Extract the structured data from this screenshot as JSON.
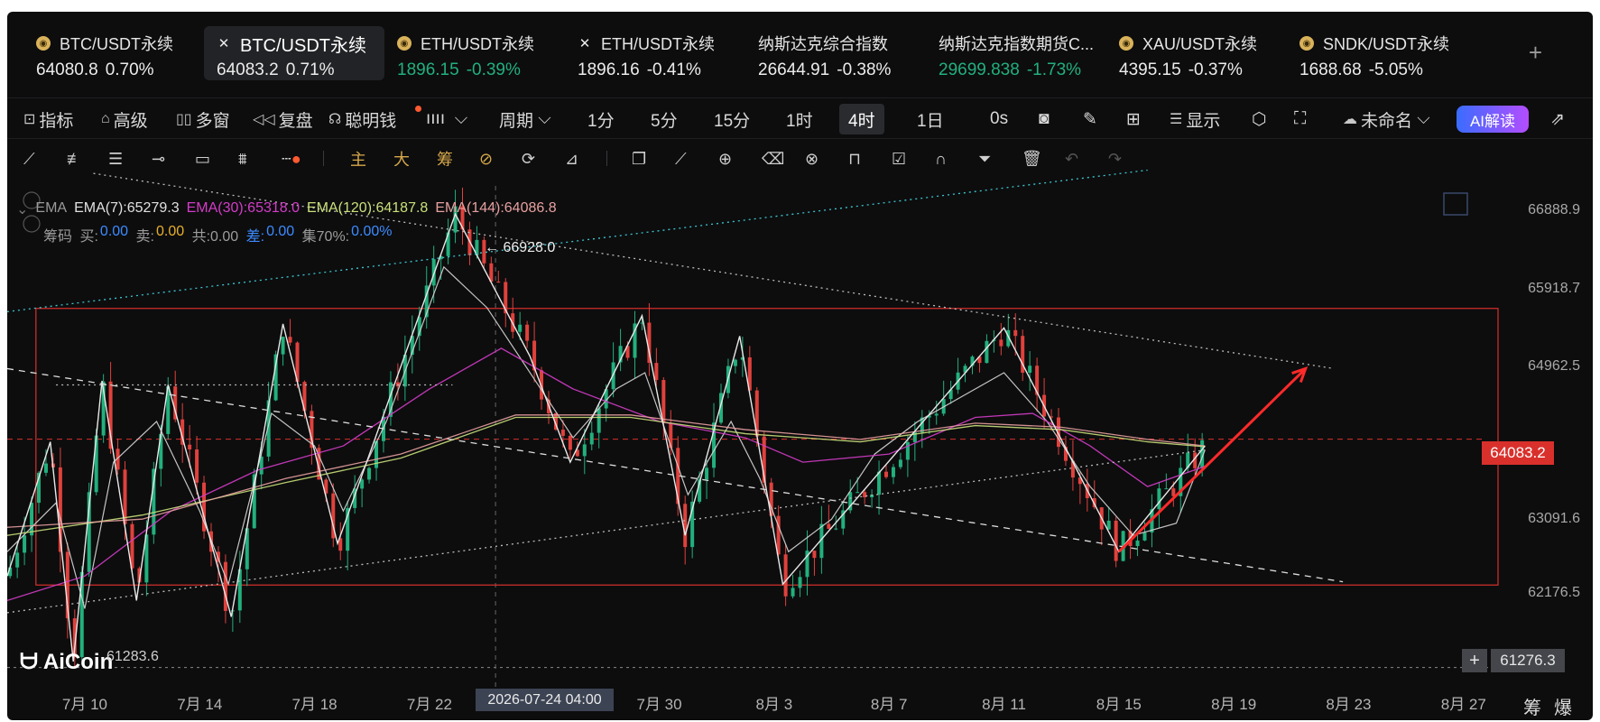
{
  "tickers": [
    {
      "name": "BTC/USDT永续",
      "price": "64080.8",
      "change": "0.70%",
      "icon": "coin-icon"
    },
    {
      "name": "BTC/USDT永续",
      "price": "64083.2",
      "change": "0.71%",
      "icon": "x-icon",
      "active": true
    },
    {
      "name": "ETH/USDT永续",
      "price": "1896.15",
      "change": "-0.39%",
      "icon": "coin-icon",
      "green": true
    },
    {
      "name": "ETH/USDT永续",
      "price": "1896.16",
      "change": "-0.41%",
      "icon": "x-icon"
    },
    {
      "name": "纳斯达克综合指数",
      "price": "26644.91",
      "change": "-0.38%",
      "icon": ""
    },
    {
      "name": "纳斯达克指数期货C...",
      "price": "29699.838",
      "change": "-1.73%",
      "icon": "",
      "green": true
    },
    {
      "name": "XAU/USDT永续",
      "price": "4395.15",
      "change": "-0.37%",
      "icon": "coin-icon"
    },
    {
      "name": "SNDK/USDT永续",
      "price": "1688.68",
      "change": "-5.05%",
      "icon": "coin-icon"
    }
  ],
  "toolbar": {
    "indicator": "指标",
    "advanced": "高级",
    "multi_window": "多窗",
    "replay": "复盘",
    "smart_money": "聪明钱",
    "period": "周期",
    "periods": [
      "1分",
      "5分",
      "15分",
      "1时",
      "4时",
      "1日"
    ],
    "active_period": "4时",
    "countdown": "0s",
    "display": "显示",
    "unnamed": "未命名",
    "ai": "AI解读"
  },
  "drawtools": {
    "main": "主",
    "big": "大",
    "chips": "筹"
  },
  "legend": {
    "ema_label": "EMA",
    "ema7": "EMA(7):65279.3",
    "ema30": "EMA(30):65318.0",
    "ema120": "EMA(120):64187.8",
    "ema144": "EMA(144):64086.8",
    "chips_label": "筹码",
    "buy_label": "买:",
    "buy_value": "0.00",
    "sell_label": "卖:",
    "sell_value": "0.00",
    "total": "共:0.00",
    "diff_label": "差:",
    "diff_value": "0.00",
    "conc_label": "集70%:",
    "conc_value": "0.00%"
  },
  "annotations": {
    "high": "66928.0",
    "low": "61283.6",
    "crosshair_time": "2026-07-24 04:00"
  },
  "logo": "AiCoin",
  "bottom_right": [
    "筹",
    "爆"
  ],
  "colors": {
    "up": "#22b07d",
    "down": "#e0413c",
    "ema7": "#d8d8d8",
    "ema30": "#d43cc8",
    "ema120": "#c9e07a",
    "ema144": "#e8a0a0",
    "accent_red": "#d9302c"
  },
  "chart_data": {
    "type": "line",
    "title": "",
    "current_price": "64083.2",
    "y_tick_labels": [
      "66888.9",
      "65918.7",
      "64962.5",
      "64083.2",
      "63091.6",
      "62176.5",
      "61276.3"
    ],
    "y_ticks": [
      66888.9,
      65918.7,
      64962.5,
      64083.2,
      63091.6,
      62176.5,
      61276.3
    ],
    "ylim": [
      61050,
      67440
    ],
    "x_tick_labels": [
      "7月 10",
      "7月 14",
      "7月 18",
      "7月 22",
      "7月 30",
      "8月 3",
      "8月 7",
      "8月 11",
      "8月 15",
      "8月 19",
      "8月 23",
      "8月 27"
    ],
    "x_tick_days": [
      10,
      14,
      18,
      22,
      30,
      34,
      38,
      42,
      46,
      50,
      54,
      58
    ],
    "xlim": [
      7.3,
      59.2
    ],
    "range_box": {
      "x": [
        8.3,
        59.2
      ],
      "y": [
        62290,
        65690
      ]
    },
    "zigzag": [
      [
        7.3,
        62400
      ],
      [
        8.8,
        64050
      ],
      [
        9.6,
        61350
      ],
      [
        10.6,
        64800
      ],
      [
        11.8,
        62100
      ],
      [
        12.9,
        64750
      ],
      [
        15.1,
        61900
      ],
      [
        16.9,
        65500
      ],
      [
        18.8,
        62800
      ],
      [
        22.9,
        66850
      ],
      [
        25.5,
        65100
      ],
      [
        26.9,
        63800
      ],
      [
        29.4,
        65600
      ],
      [
        30.9,
        62900
      ],
      [
        32.8,
        65350
      ],
      [
        34.3,
        62300
      ],
      [
        42.0,
        65450
      ],
      [
        46.0,
        62700
      ],
      [
        49.0,
        64000
      ]
    ],
    "series": [
      {
        "name": "EMA(7)",
        "values": [
          [
            7.3,
            62700
          ],
          [
            9,
            63300
          ],
          [
            10,
            62000
          ],
          [
            11,
            63800
          ],
          [
            12.5,
            64300
          ],
          [
            14,
            63200
          ],
          [
            15,
            62300
          ],
          [
            16.5,
            64400
          ],
          [
            18,
            64000
          ],
          [
            19,
            63200
          ],
          [
            20.5,
            64300
          ],
          [
            22.5,
            66200
          ],
          [
            24,
            65700
          ],
          [
            25.5,
            64900
          ],
          [
            27,
            64100
          ],
          [
            28.5,
            64700
          ],
          [
            29.5,
            64900
          ],
          [
            31,
            63400
          ],
          [
            32.5,
            64300
          ],
          [
            33.5,
            63600
          ],
          [
            34.5,
            62700
          ],
          [
            36,
            63100
          ],
          [
            37.5,
            63900
          ],
          [
            39,
            64300
          ],
          [
            40.5,
            64600
          ],
          [
            42,
            64900
          ],
          [
            43.5,
            64300
          ],
          [
            45,
            63500
          ],
          [
            46.5,
            62900
          ],
          [
            48,
            63050
          ],
          [
            49,
            63950
          ]
        ]
      },
      {
        "name": "EMA(30)",
        "values": [
          [
            7.3,
            62100
          ],
          [
            10,
            62400
          ],
          [
            13,
            63200
          ],
          [
            16,
            63700
          ],
          [
            19,
            64000
          ],
          [
            22,
            64700
          ],
          [
            24.5,
            65200
          ],
          [
            27,
            64700
          ],
          [
            30,
            64300
          ],
          [
            33,
            64100
          ],
          [
            35,
            63800
          ],
          [
            38,
            63900
          ],
          [
            41,
            64350
          ],
          [
            43,
            64400
          ],
          [
            45,
            64000
          ],
          [
            47,
            63500
          ],
          [
            49,
            63750
          ]
        ]
      },
      {
        "name": "EMA(120)",
        "values": [
          [
            7.3,
            62900
          ],
          [
            12,
            63150
          ],
          [
            17,
            63550
          ],
          [
            21,
            63850
          ],
          [
            25,
            64350
          ],
          [
            29,
            64350
          ],
          [
            33,
            64150
          ],
          [
            37,
            64050
          ],
          [
            41,
            64250
          ],
          [
            44,
            64200
          ],
          [
            47,
            64050
          ],
          [
            49,
            63990
          ]
        ]
      },
      {
        "name": "EMA(144)",
        "values": [
          [
            7.3,
            63000
          ],
          [
            12,
            63100
          ],
          [
            17,
            63600
          ],
          [
            21,
            63900
          ],
          [
            25,
            64380
          ],
          [
            29,
            64380
          ],
          [
            33,
            64200
          ],
          [
            37,
            64080
          ],
          [
            41,
            64280
          ],
          [
            44,
            64230
          ],
          [
            47,
            64080
          ],
          [
            49,
            64000
          ]
        ]
      }
    ],
    "trendlines": [
      {
        "from": [
          10.3,
          67350
        ],
        "to": [
          53.5,
          64950
        ],
        "style": "dotted",
        "color": "#bbbbbb"
      },
      {
        "from": [
          7.3,
          65650
        ],
        "to": [
          47.0,
          67390
        ],
        "style": "dotted",
        "color": "#3ec6cf"
      },
      {
        "from": [
          7.3,
          64950
        ],
        "to": [
          53.8,
          62330
        ],
        "style": "dashed",
        "color": "#dddddd"
      },
      {
        "from": [
          7.3,
          61950
        ],
        "to": [
          49.0,
          63950
        ],
        "style": "dotted",
        "color": "#bbbbbb"
      },
      {
        "from": [
          9.0,
          64750
        ],
        "to": [
          22.8,
          64750
        ],
        "style": "dotted",
        "color": "#bbbbbb"
      }
    ],
    "arrow": {
      "from": [
        46.0,
        62700
      ],
      "to": [
        52.5,
        64950
      ]
    },
    "crosshair_x": 24.3,
    "candles_generated": true
  }
}
